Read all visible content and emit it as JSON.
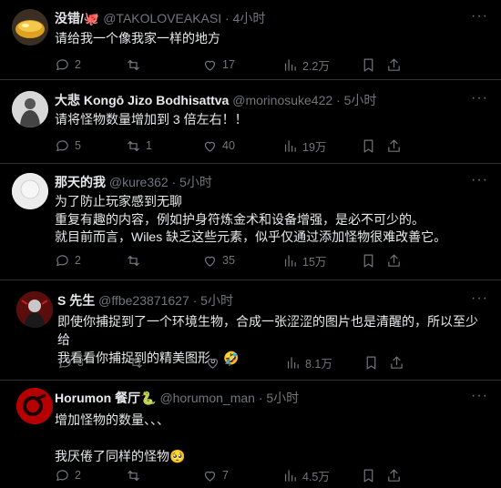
{
  "tweets": [
    {
      "name": "没错/",
      "name_emoji": "🐙",
      "handle": "@TAKOLOVEAKASI",
      "time": "· 4小时",
      "text": "请给我一个像我家一样的地方",
      "replies": "2",
      "retweets": "",
      "likes": "17",
      "views": "2.2万"
    },
    {
      "name": "大悲 Kongō Jizo Bodhisattva",
      "handle": "@morinosuke422",
      "time": "· 5小时",
      "text": "请将怪物数量增加到 3 倍左右！！",
      "replies": "5",
      "retweets": "1",
      "likes": "40",
      "views": "19万"
    },
    {
      "name": "那天的我",
      "handle": "@kure362",
      "time": "· 5小时",
      "text": "为了防止玩家感到无聊\n重复有趣的内容，例如护身符炼金术和设备增强，是必不可少的。\n就目前而言，Wiles 缺乏这些元素，似乎仅通过添加怪物很难改善它。",
      "replies": "2",
      "retweets": "",
      "likes": "35",
      "views": "15万"
    },
    {
      "name": "S 先生",
      "handle": "@ffbe23871627",
      "time": "· 5小时",
      "text": "即使你捕捉到了一个环境生物，合成一张涩涩的图片也是清醒的，所以至少给\n我看看你捕捉到的精美图形。",
      "text_emoji": "🤣",
      "replies": "3",
      "retweets": "",
      "likes": "4",
      "views": "8.1万"
    },
    {
      "name": "Horumon 餐厅",
      "name_emoji": "🐍",
      "handle": "@horumon_man",
      "time": "· 5小时",
      "text": "增加怪物的数量、、、\n\n我厌倦了同样的怪物",
      "text_emoji": "🥺",
      "replies": "2",
      "retweets": "",
      "likes": "7",
      "views": "4.5万"
    }
  ],
  "more_icon": "···",
  "colors": {
    "bg": "#000000",
    "text": "#e7e9ea",
    "muted": "#71767b",
    "divider": "#2f3336"
  }
}
